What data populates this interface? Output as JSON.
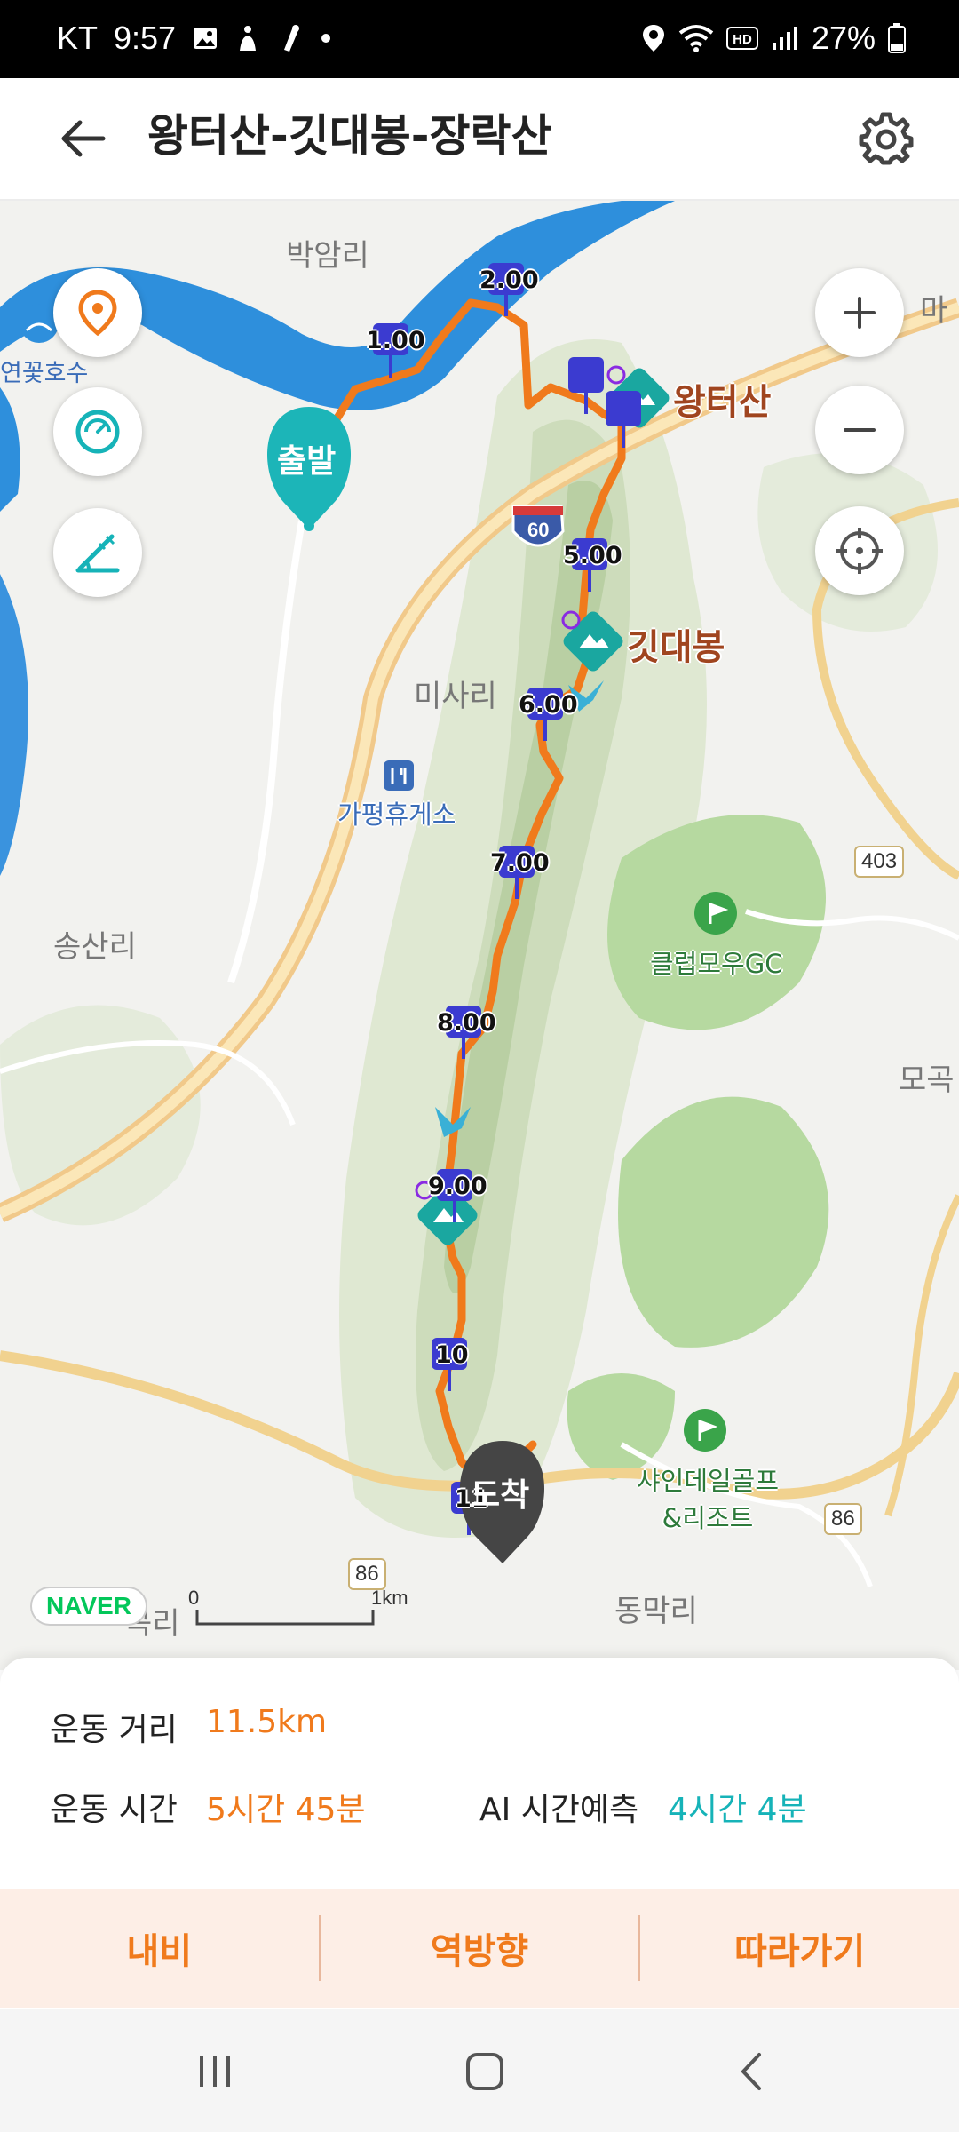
{
  "status_bar": {
    "carrier": "KT",
    "time": "9:57",
    "battery": "27%",
    "icons": [
      "gallery-icon",
      "accessibility-icon",
      "mic-icon",
      "dot-icon",
      "location-icon",
      "wifi-icon",
      "hd-icon",
      "signal-icon",
      "battery-icon"
    ]
  },
  "header": {
    "title": "왕터산-깃대봉-장락산",
    "back_icon": "back-arrow-icon",
    "settings_icon": "gear-icon"
  },
  "map": {
    "place_labels": {
      "bakam": "박암리",
      "yeonkkot": "연꽃호수",
      "misa": "미사리",
      "songsan": "송산리",
      "dongmak": "동막리",
      "ma": "마",
      "mogok": "모곡",
      "gokri": "곡리"
    },
    "peaks": {
      "wangteo": "왕터산",
      "gitdae": "깃대봉"
    },
    "pois": {
      "rest_area": "가평휴게소",
      "club_gc": "클럽모우GC",
      "shine_line1": "샤인데일골프",
      "shine_line2": "&리조트"
    },
    "road_numbers": {
      "r60": "60",
      "r403": "403",
      "r86a": "86",
      "r86b": "86"
    },
    "km_markers": [
      "1.00",
      "2.00",
      "5.00",
      "6.00",
      "7.00",
      "8.00",
      "9.00",
      "10",
      "11"
    ],
    "start_label": "출발",
    "end_label": "도착",
    "logo": "NAVER",
    "scale": {
      "zero": "0",
      "one": "1km"
    },
    "controls": {
      "location_icon": "location-pin-icon",
      "speed_icon": "speedometer-icon",
      "elevation_icon": "elevation-icon",
      "zoom_in_icon": "plus-icon",
      "zoom_out_icon": "minus-icon",
      "locate_icon": "crosshair-icon"
    },
    "colors": {
      "route": "#f07a1c",
      "accent_teal": "#16b3b8",
      "marker": "#3b3bd0"
    }
  },
  "stats": {
    "distance_label": "운동 거리",
    "distance_value": "11.5km",
    "time_label": "운동 시간",
    "time_value": "5시간 45분",
    "ai_label": "AI 시간예측",
    "ai_value": "4시간 4분"
  },
  "actions": {
    "navi": "내비",
    "reverse": "역방향",
    "follow": "따라가기"
  },
  "nav_bar": {
    "recent_icon": "recent-apps-icon",
    "home_icon": "home-icon",
    "back_icon": "back-chevron-icon"
  }
}
